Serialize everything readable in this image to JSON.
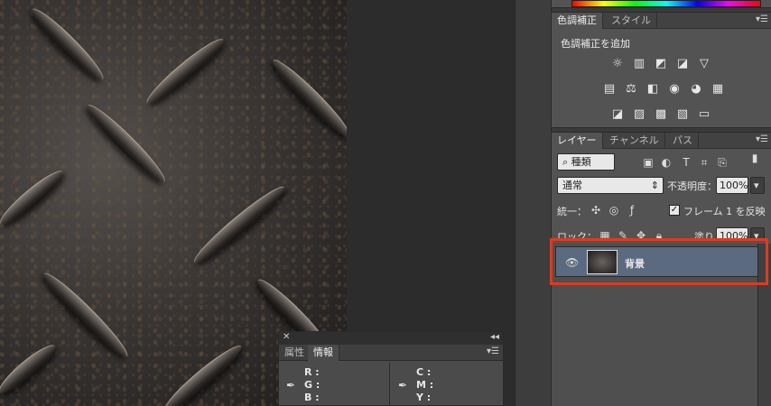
{
  "adjustments": {
    "tabs": [
      "色調補正",
      "スタイル"
    ],
    "title": "色調補正を追加",
    "row1": [
      "☼",
      "▥",
      "◩",
      "◪",
      "▽"
    ],
    "row2": [
      "▤",
      "⚖",
      "◧",
      "◉",
      "◕",
      "▦"
    ],
    "row3": [
      "◪",
      "▨",
      "▩",
      "▧",
      "▭"
    ]
  },
  "layers": {
    "tabs": [
      "レイヤー",
      "チャンネル",
      "パス"
    ],
    "filter_label": "⌕ 種類",
    "blend_mode": "通常",
    "opacity_label": "不透明度：",
    "opacity_value": "100%",
    "unify_label": "統一：",
    "propagate_label": "フレーム 1 を反映",
    "propagate_checked": "✓",
    "lock_label": "ロック：",
    "fill_label": "塗り：",
    "fill_value": "100%",
    "layer_name": "背景"
  },
  "info": {
    "tabs": [
      "属性",
      "情報"
    ],
    "left": [
      "R :",
      "G :",
      "B :"
    ],
    "right": [
      "C :",
      "M :",
      "Y :"
    ]
  },
  "colors": {
    "highlight": "#e03a20",
    "selected_layer": "#5c6a80"
  }
}
